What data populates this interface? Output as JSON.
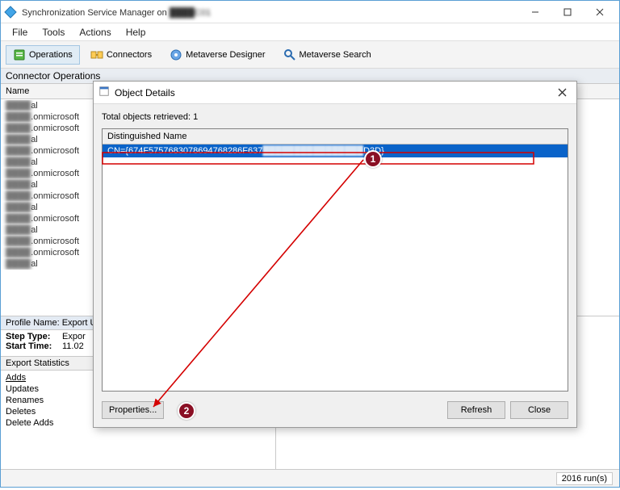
{
  "titlebar": {
    "title_prefix": "Synchronization Service Manager on ",
    "title_host": "████C01"
  },
  "menubar": [
    "File",
    "Tools",
    "Actions",
    "Help"
  ],
  "toolbar": {
    "operations": "Operations",
    "connectors": "Connectors",
    "metaverse_designer": "Metaverse Designer",
    "metaverse_search": "Metaverse Search"
  },
  "section": {
    "connector_ops": "Connector Operations"
  },
  "list": {
    "name_header": "Name",
    "rows": [
      "████al",
      "████.onmicrosoft",
      "████.onmicrosoft",
      "████al",
      "████.onmicrosoft",
      "████al",
      "████.onmicrosoft",
      "████al",
      "████.onmicrosoft",
      "████al",
      "████.onmicrosoft",
      "████al",
      "████.onmicrosoft",
      "████.onmicrosoft",
      "████al"
    ]
  },
  "profile": {
    "header": "Profile Name: Export   U",
    "step_type_k": "Step Type:",
    "step_type_v": "Expor",
    "start_time_k": "Start Time:",
    "start_time_v": "11.02"
  },
  "stats": {
    "header": "Export Statistics",
    "items": [
      "Adds",
      "Updates",
      "Renames",
      "Deletes",
      "Delete Adds"
    ]
  },
  "statusbar": {
    "runs": "2016 run(s)"
  },
  "dialog": {
    "title": "Object Details",
    "count": "Total objects retrieved: 1",
    "col_header": "Distinguished Name",
    "row_prefix": "CN={674F5757683078694768286F637",
    "row_suffix": "D3D}",
    "btn_properties": "Properties...",
    "btn_refresh": "Refresh",
    "btn_close": "Close"
  },
  "annotations": {
    "n1": "1",
    "n2": "2"
  }
}
